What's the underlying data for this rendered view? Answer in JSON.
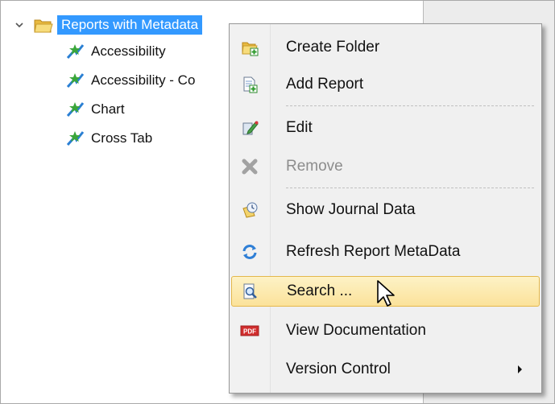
{
  "tree": {
    "root": {
      "label": "Reports with Metadata",
      "icon": "folder-icon",
      "expanded": true
    },
    "children": [
      {
        "label": "Accessibility",
        "icon": "report-icon"
      },
      {
        "label": "Accessibility  - Co",
        "icon": "report-icon"
      },
      {
        "label": "Chart",
        "icon": "report-icon"
      },
      {
        "label": "Cross Tab",
        "icon": "report-icon"
      }
    ]
  },
  "context_menu": {
    "items": [
      {
        "label": "Create Folder",
        "icon": "create-folder-icon",
        "enabled": true
      },
      {
        "label": "Add Report",
        "icon": "add-report-icon",
        "enabled": true
      },
      {
        "label": "Edit",
        "icon": "edit-icon",
        "enabled": true
      },
      {
        "label": "Remove",
        "icon": "remove-icon",
        "enabled": false
      },
      {
        "label": "Show Journal Data",
        "icon": "journal-icon",
        "enabled": true
      },
      {
        "label": "Refresh Report MetaData",
        "icon": "refresh-icon",
        "enabled": true
      },
      {
        "label": "Search ...",
        "icon": "search-icon",
        "enabled": true,
        "highlighted": true
      },
      {
        "label": "View Documentation",
        "icon": "pdf-icon",
        "enabled": true
      },
      {
        "label": "Version Control",
        "icon": "",
        "enabled": true,
        "has_submenu": true
      }
    ]
  },
  "colors": {
    "selection": "#3399ff",
    "menu_highlight": "#fbe29a",
    "menu_background": "#f0f0f0",
    "disabled_text": "#8d8d8d"
  }
}
